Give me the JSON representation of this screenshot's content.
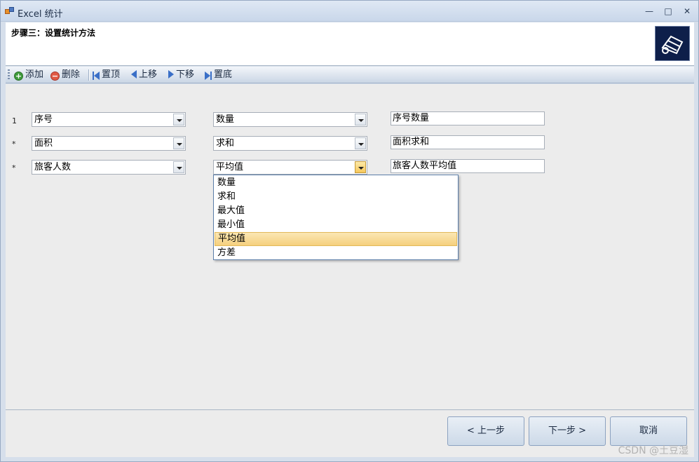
{
  "window": {
    "title": "Excel 统计"
  },
  "header": {
    "title": "步骤三：设置统计方法"
  },
  "toolbar": {
    "add": "添加",
    "delete": "删除",
    "top": "置顶",
    "up": "上移",
    "down": "下移",
    "bottom": "置底"
  },
  "rows": [
    {
      "label": "1",
      "field": "序号",
      "method": "数量",
      "name": "序号数量"
    },
    {
      "label": "*",
      "field": "面积",
      "method": "求和",
      "name": "面积求和"
    },
    {
      "label": "*",
      "field": "旅客人数",
      "method": "平均值",
      "name": "旅客人数平均值"
    }
  ],
  "dropdown": {
    "options": [
      "数量",
      "求和",
      "最大值",
      "最小值",
      "平均值",
      "方差"
    ],
    "selected": "平均值"
  },
  "footer": {
    "prev": "< 上一步",
    "next": "下一步 >",
    "cancel": "取消"
  },
  "watermark": "CSDN @土豆湿"
}
